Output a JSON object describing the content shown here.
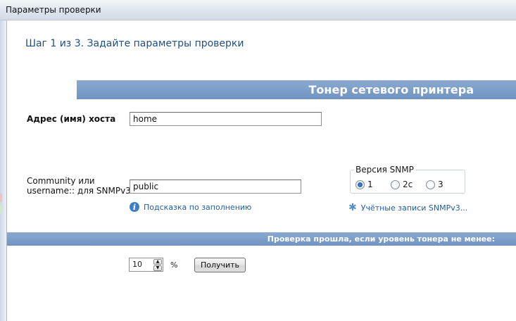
{
  "window": {
    "title": "Параметры проверки"
  },
  "step_title": "Шаг 1 из 3. Задайте параметры проверки",
  "section_title": "Тонер сетевого принтера",
  "host": {
    "label": "Адрес (имя) хоста",
    "value": "home"
  },
  "community": {
    "label_line1": "Community или",
    "label_line2": "username:: для SNMPv3",
    "value": "public"
  },
  "snmp_version": {
    "legend": "Версия SNMP",
    "options": [
      "1",
      "2c",
      "3"
    ],
    "selected": "1"
  },
  "hint_link": "Подсказка по заполнению",
  "snmp_accounts_link": "Учётные записи SNMPv3...",
  "check_band": "Проверка прошла, если уровень тонера не менее:",
  "threshold": {
    "value": "10",
    "unit": "%"
  },
  "get_button": "Получить"
}
